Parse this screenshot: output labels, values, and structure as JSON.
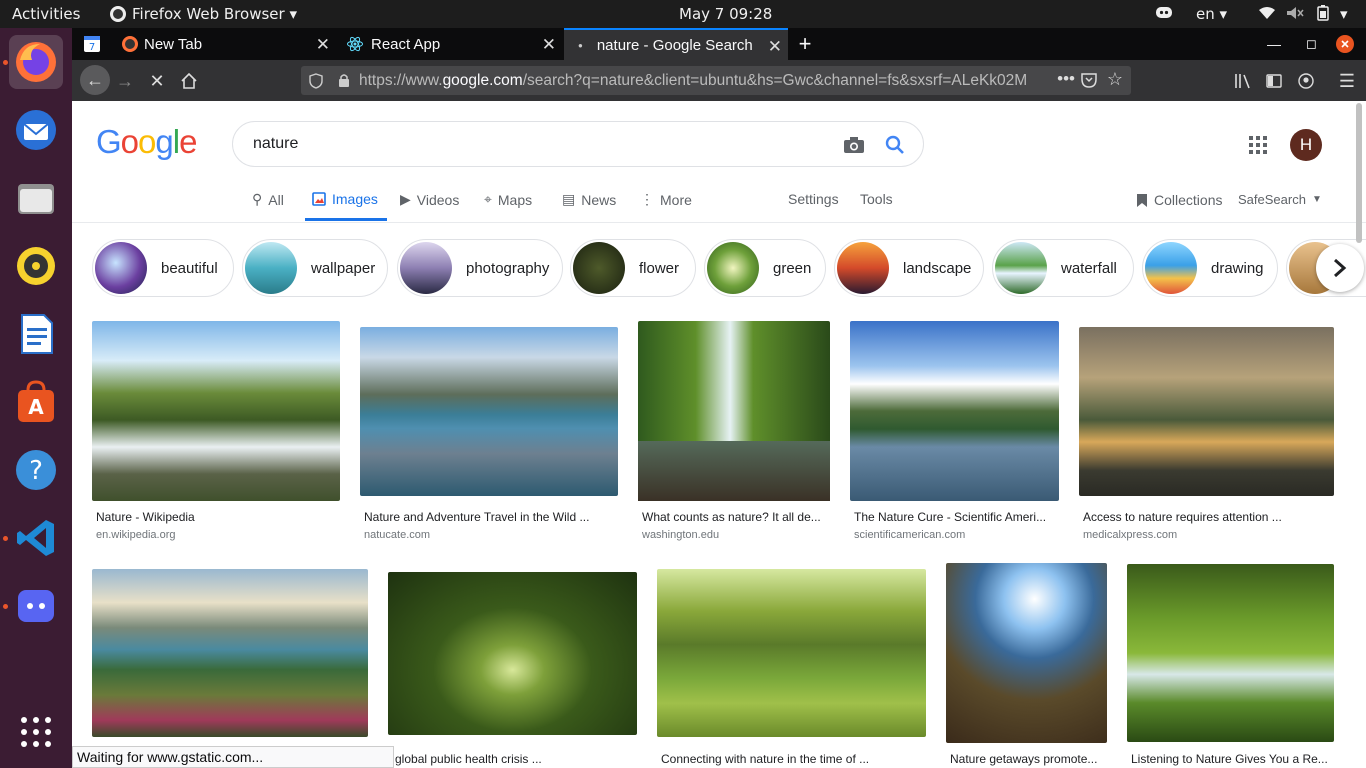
{
  "topbar": {
    "activities": "Activities",
    "app": "Firefox Web Browser",
    "clock": "May 7  09:28",
    "lang": "en"
  },
  "tabs": [
    {
      "label": ""
    },
    {
      "label": "New Tab"
    },
    {
      "label": "React App"
    },
    {
      "label": "nature - Google Search"
    }
  ],
  "nav": {
    "url_prefix": "https://www.",
    "url_host": "google.com",
    "url_rest": "/search?q=nature&client=ubuntu&hs=Gwc&channel=fs&sxsrf=ALeKk02M"
  },
  "google": {
    "logo": "Google",
    "query": "nature",
    "avatar": "H",
    "tabs": [
      "All",
      "Images",
      "Videos",
      "Maps",
      "News",
      "More"
    ],
    "settings": "Settings",
    "tools": "Tools",
    "collections": "Collections",
    "safesearch": "SafeSearch"
  },
  "chips": [
    "beautiful",
    "wallpaper",
    "photography",
    "flower",
    "green",
    "landscape",
    "waterfall",
    "drawing"
  ],
  "results_row1": [
    {
      "title": "Nature - Wikipedia",
      "source": "en.wikipedia.org"
    },
    {
      "title": "Nature and Adventure Travel in the Wild ...",
      "source": "natucate.com"
    },
    {
      "title": "What counts as nature? It all de...",
      "source": "washington.edu"
    },
    {
      "title": "The Nature Cure - Scientific Ameri...",
      "source": "scientificamerican.com"
    },
    {
      "title": "Access to nature requires attention ...",
      "source": "medicalxpress.com"
    }
  ],
  "results_row2": [
    {
      "title": "global public health crisis ..."
    },
    {
      "title": "Connecting with nature in the time of ..."
    },
    {
      "title": "Nature getaways promote..."
    },
    {
      "title": "Listening to Nature Gives You a Re..."
    }
  ],
  "status": "Waiting for www.gstatic.com..."
}
